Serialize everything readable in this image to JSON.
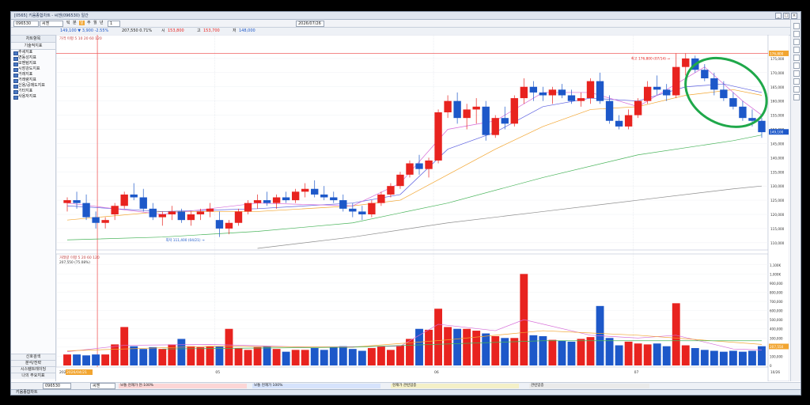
{
  "window": {
    "title": "[0565] 키움종합차트 - 씨젠(096530) 일간",
    "controls": [
      "_",
      "□",
      "×"
    ]
  },
  "toolbar": {
    "code": "096530",
    "name": "씨젠",
    "period_tabs": [
      "틱",
      "분",
      "일",
      "주",
      "월",
      "년"
    ],
    "date": "2026/07/26",
    "count": "1"
  },
  "infobar": {
    "price_text": "149,100 ▼ 3,900 -2.55%",
    "volume_text": "207,550  0.71%",
    "open_label": "시",
    "open": "153,800",
    "high_label": "고",
    "high": "153,700",
    "low_label": "저",
    "low": "148,000"
  },
  "sidebar": {
    "top_title": "차트항목",
    "section_title": "기술적지표",
    "items": [
      "추세지표",
      "변동성지표",
      "모멘텀지표",
      "시장강도지표",
      "거래지표",
      "거래량지표",
      "신용/공매도지표",
      "기타지표",
      "사용자지표"
    ],
    "bottom_items": [
      "신호검색",
      "분석/전략",
      "시스템트레이딩",
      "나의 주요지표"
    ]
  },
  "price_panel": {
    "legend": "가격 이평 5 10 20 60 120",
    "high_annotation": "최고 176,800 (07/14) →",
    "low_annotation": "최저 111,400 (04/21) →",
    "current_price_tag": "149,100",
    "ref_price_tag": "176,800",
    "high_value": 176800,
    "low_value": 111400,
    "y_ticks": [
      "175,000",
      "170,000",
      "165,000",
      "160,000",
      "155,000",
      "150,000",
      "145,000",
      "140,000",
      "135,000",
      "130,000",
      "125,000",
      "120,000",
      "115,000",
      "110,000"
    ],
    "top_tag": "176,800"
  },
  "volume_panel": {
    "legend": "거래량 이평 5 20 60 120",
    "legend2": "207,550 (75.08%)",
    "y_ticks": [
      "1,100K",
      "1,000K",
      "900,000",
      "800,000",
      "700,000",
      "600,000",
      "500,000",
      "400,000",
      "300,000",
      "200,000",
      "100,000",
      "0"
    ],
    "current_tag": "207,550"
  },
  "x_axis": {
    "labels": [
      "2026",
      "05",
      "06",
      "07"
    ],
    "highlight": "2026/04/21",
    "last_label": "10/26"
  },
  "annotation": {
    "shape": "ellipse",
    "color": "#1fa84a"
  },
  "bottombar": {
    "code": "096530",
    "name": "씨젠",
    "segments": [
      "보통  현재가  현:100%",
      "보통  현재가  100%",
      "현재가  관련업종",
      "관련업종"
    ]
  },
  "statusbar": {
    "text": "키움종합차트"
  },
  "colors": {
    "up": "#e8231f",
    "down": "#1d58c9",
    "ma5": "#d66bd8",
    "ma10": "#5b5fe0",
    "ma20": "#f2a530",
    "ma60": "#48b45a",
    "ma120": "#8c8c8c",
    "circle": "#1fa84a"
  },
  "chart_data": {
    "type": "candlestick",
    "price": {
      "ylim": [
        108000,
        180000
      ],
      "candles": [
        [
          124000,
          126000,
          121000,
          125000
        ],
        [
          125000,
          128000,
          122000,
          124000
        ],
        [
          124000,
          127000,
          118000,
          119000
        ],
        [
          119000,
          121000,
          115000,
          117000
        ],
        [
          117000,
          119000,
          115000,
          118000
        ],
        [
          120000,
          124000,
          118000,
          123000
        ],
        [
          123000,
          128000,
          122000,
          127000
        ],
        [
          127000,
          131000,
          125000,
          126000
        ],
        [
          126000,
          129000,
          121000,
          122000
        ],
        [
          122000,
          124000,
          118000,
          119000
        ],
        [
          119000,
          121000,
          116000,
          120000
        ],
        [
          120000,
          123000,
          118000,
          121000
        ],
        [
          121000,
          122000,
          117000,
          118000
        ],
        [
          118000,
          121000,
          116000,
          120000
        ],
        [
          120000,
          122000,
          118000,
          121000
        ],
        [
          121000,
          124000,
          119000,
          122000
        ],
        [
          118000,
          121000,
          112000,
          115000
        ],
        [
          115000,
          118000,
          113000,
          117000
        ],
        [
          117000,
          122000,
          116000,
          121000
        ],
        [
          121000,
          125000,
          120000,
          124000
        ],
        [
          124000,
          127000,
          122000,
          125000
        ],
        [
          125000,
          128000,
          123000,
          124000
        ],
        [
          124000,
          127000,
          122000,
          126000
        ],
        [
          126000,
          128000,
          124000,
          125000
        ],
        [
          125000,
          129000,
          124000,
          128000
        ],
        [
          128000,
          131000,
          126000,
          129000
        ],
        [
          129000,
          132000,
          126000,
          127000
        ],
        [
          127000,
          130000,
          125000,
          126000
        ],
        [
          126000,
          128000,
          124000,
          125000
        ],
        [
          125000,
          127000,
          121000,
          122000
        ],
        [
          122000,
          124000,
          119000,
          121000
        ],
        [
          121000,
          123000,
          118000,
          120000
        ],
        [
          120000,
          125000,
          119000,
          124000
        ],
        [
          124000,
          128000,
          123000,
          127000
        ],
        [
          127000,
          131000,
          126000,
          130000
        ],
        [
          130000,
          135000,
          129000,
          134000
        ],
        [
          134000,
          139000,
          133000,
          138000
        ],
        [
          138000,
          141000,
          134000,
          136000
        ],
        [
          136000,
          140000,
          133000,
          139000
        ],
        [
          139000,
          157000,
          138000,
          156000
        ],
        [
          156000,
          162000,
          154000,
          160000
        ],
        [
          160000,
          163000,
          152000,
          154000
        ],
        [
          154000,
          159000,
          150000,
          157000
        ],
        [
          157000,
          161000,
          152000,
          158000
        ],
        [
          158000,
          160000,
          146000,
          148000
        ],
        [
          148000,
          155000,
          147000,
          154000
        ],
        [
          154000,
          158000,
          150000,
          152000
        ],
        [
          152000,
          162000,
          151000,
          161000
        ],
        [
          161000,
          168000,
          159000,
          165000
        ],
        [
          165000,
          167000,
          160000,
          163000
        ],
        [
          163000,
          165000,
          160000,
          162000
        ],
        [
          162000,
          165000,
          159000,
          164000
        ],
        [
          164000,
          166000,
          161000,
          162000
        ],
        [
          162000,
          164000,
          159000,
          160000
        ],
        [
          160000,
          163000,
          158000,
          161000
        ],
        [
          161000,
          168000,
          159000,
          167000
        ],
        [
          167000,
          170000,
          159000,
          160000
        ],
        [
          160000,
          162000,
          152000,
          153000
        ],
        [
          153000,
          155000,
          150000,
          151000
        ],
        [
          151000,
          157000,
          150000,
          155000
        ],
        [
          155000,
          161000,
          154000,
          160000
        ],
        [
          160000,
          167000,
          159000,
          165000
        ],
        [
          165000,
          169000,
          162000,
          164000
        ],
        [
          164000,
          166000,
          160000,
          162000
        ],
        [
          162000,
          176800,
          161000,
          172000
        ],
        [
          172000,
          176800,
          169000,
          175000
        ],
        [
          175000,
          176000,
          170000,
          171000
        ],
        [
          171000,
          173000,
          167000,
          168000
        ],
        [
          168000,
          170000,
          162000,
          164000
        ],
        [
          164000,
          167000,
          160000,
          161000
        ],
        [
          161000,
          163000,
          157000,
          158000
        ],
        [
          158000,
          160000,
          153000,
          154000
        ],
        [
          154000,
          157000,
          151000,
          153000
        ],
        [
          153000,
          154000,
          147000,
          149000
        ]
      ],
      "ma": {
        "ma5": [
          {
            "i": 0,
            "v": 124000
          },
          {
            "i": 10,
            "v": 120000
          },
          {
            "i": 20,
            "v": 124000
          },
          {
            "i": 30,
            "v": 123000
          },
          {
            "i": 35,
            "v": 131000
          },
          {
            "i": 40,
            "v": 150000
          },
          {
            "i": 45,
            "v": 153000
          },
          {
            "i": 50,
            "v": 163000
          },
          {
            "i": 55,
            "v": 163000
          },
          {
            "i": 60,
            "v": 158000
          },
          {
            "i": 64,
            "v": 166000
          },
          {
            "i": 67,
            "v": 172000
          },
          {
            "i": 71,
            "v": 160000
          },
          {
            "i": 73,
            "v": 155000
          }
        ],
        "ma10": [
          {
            "i": 0,
            "v": 123000
          },
          {
            "i": 10,
            "v": 121000
          },
          {
            "i": 20,
            "v": 122000
          },
          {
            "i": 30,
            "v": 124000
          },
          {
            "i": 35,
            "v": 127000
          },
          {
            "i": 40,
            "v": 143000
          },
          {
            "i": 45,
            "v": 149000
          },
          {
            "i": 50,
            "v": 158000
          },
          {
            "i": 55,
            "v": 161000
          },
          {
            "i": 60,
            "v": 160000
          },
          {
            "i": 65,
            "v": 165000
          },
          {
            "i": 69,
            "v": 166000
          },
          {
            "i": 73,
            "v": 163000
          }
        ],
        "ma20": [
          {
            "i": 0,
            "v": 118000
          },
          {
            "i": 10,
            "v": 121000
          },
          {
            "i": 20,
            "v": 121000
          },
          {
            "i": 30,
            "v": 123000
          },
          {
            "i": 35,
            "v": 125000
          },
          {
            "i": 40,
            "v": 134000
          },
          {
            "i": 45,
            "v": 143000
          },
          {
            "i": 50,
            "v": 151000
          },
          {
            "i": 55,
            "v": 157000
          },
          {
            "i": 60,
            "v": 158000
          },
          {
            "i": 65,
            "v": 162000
          },
          {
            "i": 70,
            "v": 164000
          },
          {
            "i": 73,
            "v": 162000
          }
        ],
        "ma60": [
          {
            "i": 0,
            "v": 111000
          },
          {
            "i": 10,
            "v": 112000
          },
          {
            "i": 20,
            "v": 114000
          },
          {
            "i": 30,
            "v": 117000
          },
          {
            "i": 40,
            "v": 124000
          },
          {
            "i": 50,
            "v": 133000
          },
          {
            "i": 60,
            "v": 141000
          },
          {
            "i": 70,
            "v": 146000
          },
          {
            "i": 73,
            "v": 148000
          }
        ],
        "ma120": [
          {
            "i": 20,
            "v": 108000
          },
          {
            "i": 30,
            "v": 112000
          },
          {
            "i": 40,
            "v": 117000
          },
          {
            "i": 50,
            "v": 121000
          },
          {
            "i": 60,
            "v": 125000
          },
          {
            "i": 70,
            "v": 129000
          },
          {
            "i": 73,
            "v": 130000
          }
        ]
      }
    },
    "volume": {
      "ylim": [
        0,
        1150000
      ],
      "values": [
        120000,
        120000,
        110000,
        120000,
        120000,
        230000,
        420000,
        210000,
        180000,
        200000,
        180000,
        230000,
        290000,
        210000,
        200000,
        210000,
        210000,
        400000,
        190000,
        170000,
        200000,
        210000,
        180000,
        150000,
        170000,
        170000,
        190000,
        170000,
        200000,
        210000,
        180000,
        160000,
        190000,
        210000,
        170000,
        220000,
        290000,
        400000,
        390000,
        620000,
        420000,
        400000,
        400000,
        380000,
        350000,
        320000,
        300000,
        300000,
        1000000,
        330000,
        320000,
        280000,
        270000,
        260000,
        290000,
        310000,
        650000,
        300000,
        220000,
        260000,
        240000,
        230000,
        240000,
        210000,
        680000,
        220000,
        190000,
        170000,
        160000,
        150000,
        160000,
        150000,
        160000,
        210000
      ],
      "ma5": [
        {
          "i": 0,
          "v": 150000
        },
        {
          "i": 6,
          "v": 220000
        },
        {
          "i": 15,
          "v": 230000
        },
        {
          "i": 25,
          "v": 200000
        },
        {
          "i": 35,
          "v": 210000
        },
        {
          "i": 39,
          "v": 450000
        },
        {
          "i": 45,
          "v": 380000
        },
        {
          "i": 48,
          "v": 500000
        },
        {
          "i": 55,
          "v": 330000
        },
        {
          "i": 60,
          "v": 300000
        },
        {
          "i": 64,
          "v": 330000
        },
        {
          "i": 70,
          "v": 180000
        },
        {
          "i": 73,
          "v": 170000
        }
      ],
      "ma20": [
        {
          "i": 0,
          "v": 160000
        },
        {
          "i": 15,
          "v": 210000
        },
        {
          "i": 30,
          "v": 200000
        },
        {
          "i": 40,
          "v": 280000
        },
        {
          "i": 50,
          "v": 380000
        },
        {
          "i": 60,
          "v": 330000
        },
        {
          "i": 73,
          "v": 230000
        }
      ],
      "ma60": [
        {
          "i": 10,
          "v": 180000
        },
        {
          "i": 30,
          "v": 200000
        },
        {
          "i": 50,
          "v": 270000
        },
        {
          "i": 73,
          "v": 270000
        }
      ]
    }
  }
}
